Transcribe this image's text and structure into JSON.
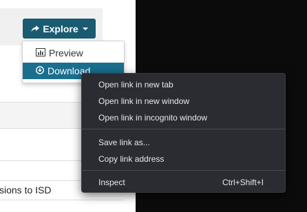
{
  "explore_button": {
    "label": "Explore",
    "icon": "share-arrow-icon"
  },
  "dropdown": {
    "items": [
      {
        "label": "Preview",
        "icon": "bar-chart-icon"
      },
      {
        "label": "Download",
        "icon": "download-circle-icon",
        "highlighted": true
      }
    ]
  },
  "page": {
    "row_text": "ssions to ISD"
  },
  "context_menu": {
    "groups": [
      [
        "Open link in new tab",
        "Open link in new window",
        "Open link in incognito window"
      ],
      [
        "Save link as...",
        "Copy link address"
      ],
      [
        "Inspect"
      ]
    ],
    "inspect_shortcut": "Ctrl+Shift+I"
  },
  "colors": {
    "accent": "#1a5b71",
    "highlight": "#1a6f8f",
    "menu_bg": "#2a2c31",
    "menu_text": "#e8e8e8",
    "backdrop": "#0b0b0b"
  }
}
